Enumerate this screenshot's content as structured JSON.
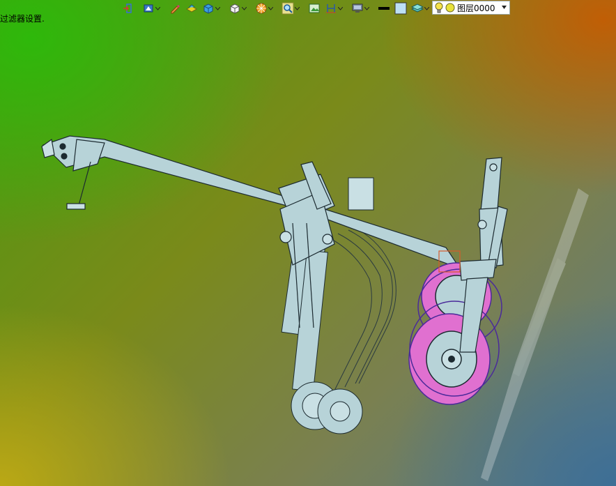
{
  "toolbar": {
    "items": [
      {
        "name": "exit-sketch-icon",
        "has_dropdown": false
      },
      {
        "name": "display-mode-icon",
        "has_dropdown": true
      },
      {
        "name": "pencil-sketch-icon",
        "has_dropdown": false
      },
      {
        "name": "shaded-model-icon",
        "has_dropdown": false
      },
      {
        "name": "view-cube-icon",
        "has_dropdown": true
      },
      {
        "name": "box-outline-icon",
        "has_dropdown": true
      },
      {
        "name": "appearance-sphere-icon",
        "has_dropdown": true
      },
      {
        "name": "zoom-search-icon",
        "has_dropdown": true
      },
      {
        "name": "image-frame-icon",
        "has_dropdown": false
      },
      {
        "name": "section-plane-icon",
        "has_dropdown": true
      },
      {
        "name": "monitor-display-icon",
        "has_dropdown": true
      },
      {
        "name": "line-color-swatch-icon",
        "has_dropdown": false
      },
      {
        "name": "fill-color-swatch-icon",
        "has_dropdown": false
      },
      {
        "name": "layer-stack-icon",
        "has_dropdown": true
      }
    ]
  },
  "layer": {
    "current": "图层0000",
    "bulb_color": "#f5e24a",
    "status_color": "#e8e23a"
  },
  "status": {
    "message": "过滤器设置."
  },
  "colors": {
    "part_fill": "#b7d3d8",
    "part_edge": "#1c2a30",
    "tire": "#e070d0",
    "tire_edge": "#4a2a9a"
  }
}
